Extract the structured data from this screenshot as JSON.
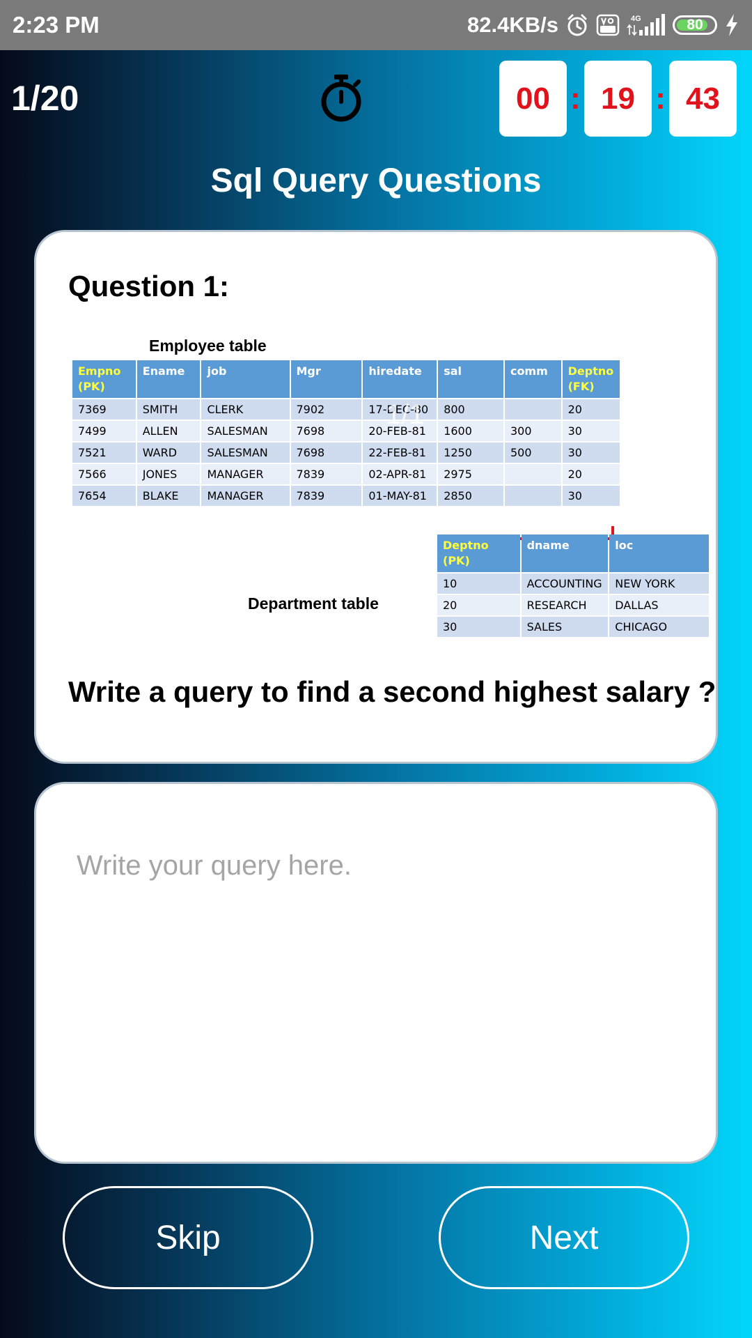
{
  "status_bar": {
    "time": "2:23 PM",
    "network_speed": "82.4KB/s",
    "network_type": "4G",
    "volte_label": "Vo LTE",
    "battery_level": "80",
    "icons": [
      "alarm-icon",
      "volte-icon",
      "signal-icon",
      "battery-icon",
      "charging-icon"
    ]
  },
  "header": {
    "progress": "1/20",
    "stopwatch_icon": "stopwatch-icon",
    "timer": {
      "hours": "00",
      "minutes": "19",
      "seconds": "43",
      "separator": ":"
    },
    "title": "Sql Query Questions"
  },
  "question": {
    "label": "Question 1:",
    "image_page_indicator": "1/1",
    "employee_table": {
      "caption": "Employee table",
      "columns": [
        {
          "label": "Empno (PK)",
          "key": true
        },
        {
          "label": "Ename",
          "key": false
        },
        {
          "label": "job",
          "key": false
        },
        {
          "label": "Mgr",
          "key": false
        },
        {
          "label": "hiredate",
          "key": false
        },
        {
          "label": "sal",
          "key": false
        },
        {
          "label": "comm",
          "key": false
        },
        {
          "label": "Deptno (FK)",
          "key": true
        }
      ],
      "rows": [
        [
          "7369",
          "SMITH",
          "CLERK",
          "7902",
          "17-DEC-80",
          "800",
          "",
          "20"
        ],
        [
          "7499",
          "ALLEN",
          "SALESMAN",
          "7698",
          "20-FEB-81",
          "1600",
          "300",
          "30"
        ],
        [
          "7521",
          "WARD",
          "SALESMAN",
          "7698",
          "22-FEB-81",
          "1250",
          "500",
          "30"
        ],
        [
          "7566",
          "JONES",
          "MANAGER",
          "7839",
          "02-APR-81",
          "2975",
          "",
          "20"
        ],
        [
          "7654",
          "BLAKE",
          "MANAGER",
          "7839",
          "01-MAY-81",
          "2850",
          "",
          "30"
        ]
      ]
    },
    "department_table": {
      "caption": "Department table",
      "columns": [
        {
          "label": "Deptno (PK)",
          "key": true
        },
        {
          "label": "dname",
          "key": false
        },
        {
          "label": "loc",
          "key": false
        }
      ],
      "rows": [
        [
          "10",
          "ACCOUNTING",
          "NEW YORK"
        ],
        [
          "20",
          "RESEARCH",
          "DALLAS"
        ],
        [
          "30",
          "SALES",
          "CHICAGO"
        ]
      ]
    },
    "text": "Write a query to find a second highest salary ?"
  },
  "answer": {
    "placeholder": "Write your query here.",
    "value": ""
  },
  "buttons": {
    "skip_label": "Skip",
    "next_label": "Next"
  },
  "colors": {
    "timer_digits": "#e0131c",
    "table_header": "#5b9bd5",
    "key_header_text": "#ffff3c",
    "fk_link": "#e0131c"
  }
}
